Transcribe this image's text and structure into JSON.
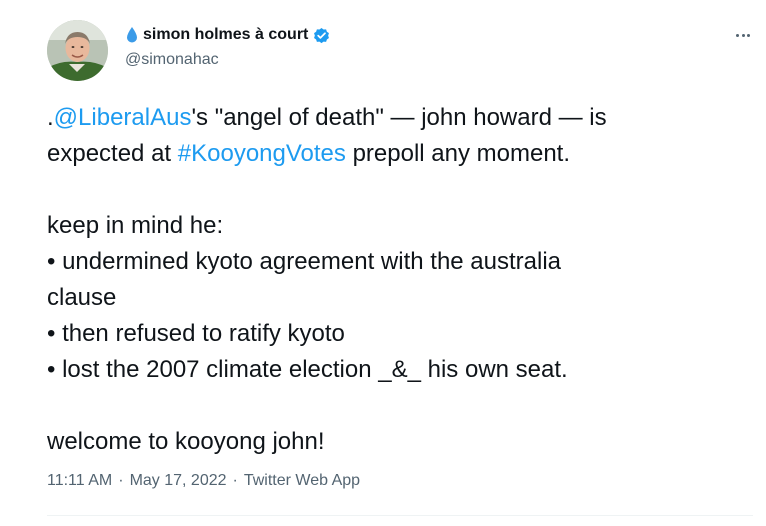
{
  "author": {
    "display_name": "simon holmes à court",
    "handle": "@simonahac",
    "name_emoji_icon": "water-drop-icon",
    "verified_icon": "verified-badge-icon"
  },
  "more_menu_icon": "more-horizontal-icon",
  "tweet": {
    "line1_prefix": ".",
    "mention": "@LiberalAus",
    "line1_rest": "'s \"angel of death\" — john howard — is",
    "line2_prefix": "expected at ",
    "hashtag": "#KooyongVotes",
    "line2_rest": " prepoll any moment.",
    "para2": "keep in mind he:\n• undermined kyoto agreement with the australia\nclause\n• then refused to ratify kyoto\n• lost the 2007 climate election _&_ his own seat.",
    "para3": "welcome to kooyong john!"
  },
  "meta": {
    "time": "11:11 AM",
    "date": "May 17, 2022",
    "separator": "·",
    "source": "Twitter Web App"
  },
  "colors": {
    "link": "#1d9bf0",
    "text": "#0f1419",
    "secondary": "#536471"
  }
}
